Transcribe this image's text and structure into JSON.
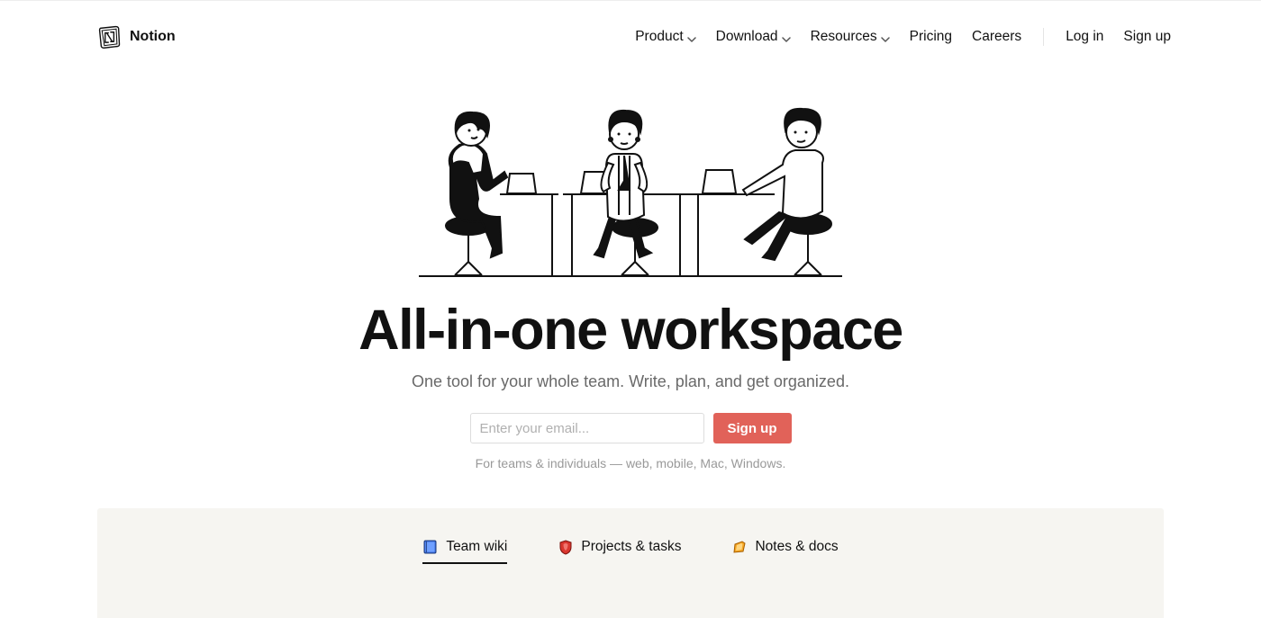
{
  "brand": {
    "name": "Notion"
  },
  "nav": {
    "left": [
      {
        "label": "Product",
        "dropdown": true
      },
      {
        "label": "Download",
        "dropdown": true
      },
      {
        "label": "Resources",
        "dropdown": true
      },
      {
        "label": "Pricing",
        "dropdown": false
      },
      {
        "label": "Careers",
        "dropdown": false
      }
    ],
    "right": [
      {
        "label": "Log in"
      },
      {
        "label": "Sign up"
      }
    ]
  },
  "hero": {
    "title": "All-in-one workspace",
    "subtitle": "One tool for your whole team. Write, plan, and get organized.",
    "email_placeholder": "Enter your email...",
    "signup_button": "Sign up",
    "sub_note": "For teams & individuals — web, mobile, Mac, Windows."
  },
  "tabs": [
    {
      "label": "Team wiki",
      "icon": "book-icon",
      "color": "#3b82f6",
      "active": true
    },
    {
      "label": "Projects & tasks",
      "icon": "shield-icon",
      "color": "#dc2626",
      "active": false
    },
    {
      "label": "Notes & docs",
      "icon": "note-icon",
      "color": "#f59e0b",
      "active": false
    }
  ]
}
